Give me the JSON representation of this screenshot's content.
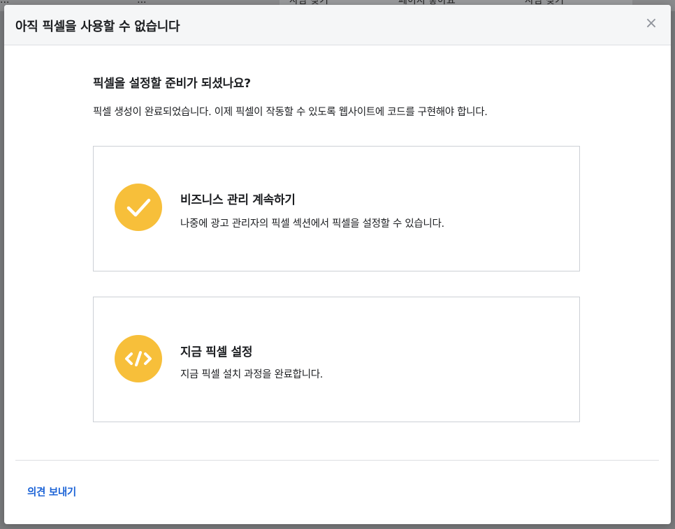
{
  "background": {
    "left_text": "...",
    "left_text2": "··· ···...",
    "buttons": [
      "사람 찾기",
      "페이지 좋아요",
      "사람 찾기"
    ]
  },
  "modal": {
    "title": "아직 픽셀을 사용할 수 없습니다",
    "close_icon": "×",
    "heading": "픽셀을 설정할 준비가 되셨나요?",
    "description": "픽셀 생성이 완료되었습니다. 이제 픽셀이 작동할 수 있도록 웹사이트에 코드를 구현해야 합니다.",
    "options": [
      {
        "icon": "check-icon",
        "title": "비즈니스 관리 계속하기",
        "description": "나중에 광고 관리자의 픽셀 섹션에서 픽셀을 설정할 수 있습니다."
      },
      {
        "icon": "code-icon",
        "title": "지금 픽셀 설정",
        "description": "지금 픽셀 설치 과정을 완료합니다."
      }
    ],
    "feedback_label": "의견 보내기"
  },
  "colors": {
    "accent_icon": "#f7bf3a",
    "link": "#1a62d6",
    "header_bg": "#f5f6f7",
    "overlay": "#7a7b7d"
  }
}
